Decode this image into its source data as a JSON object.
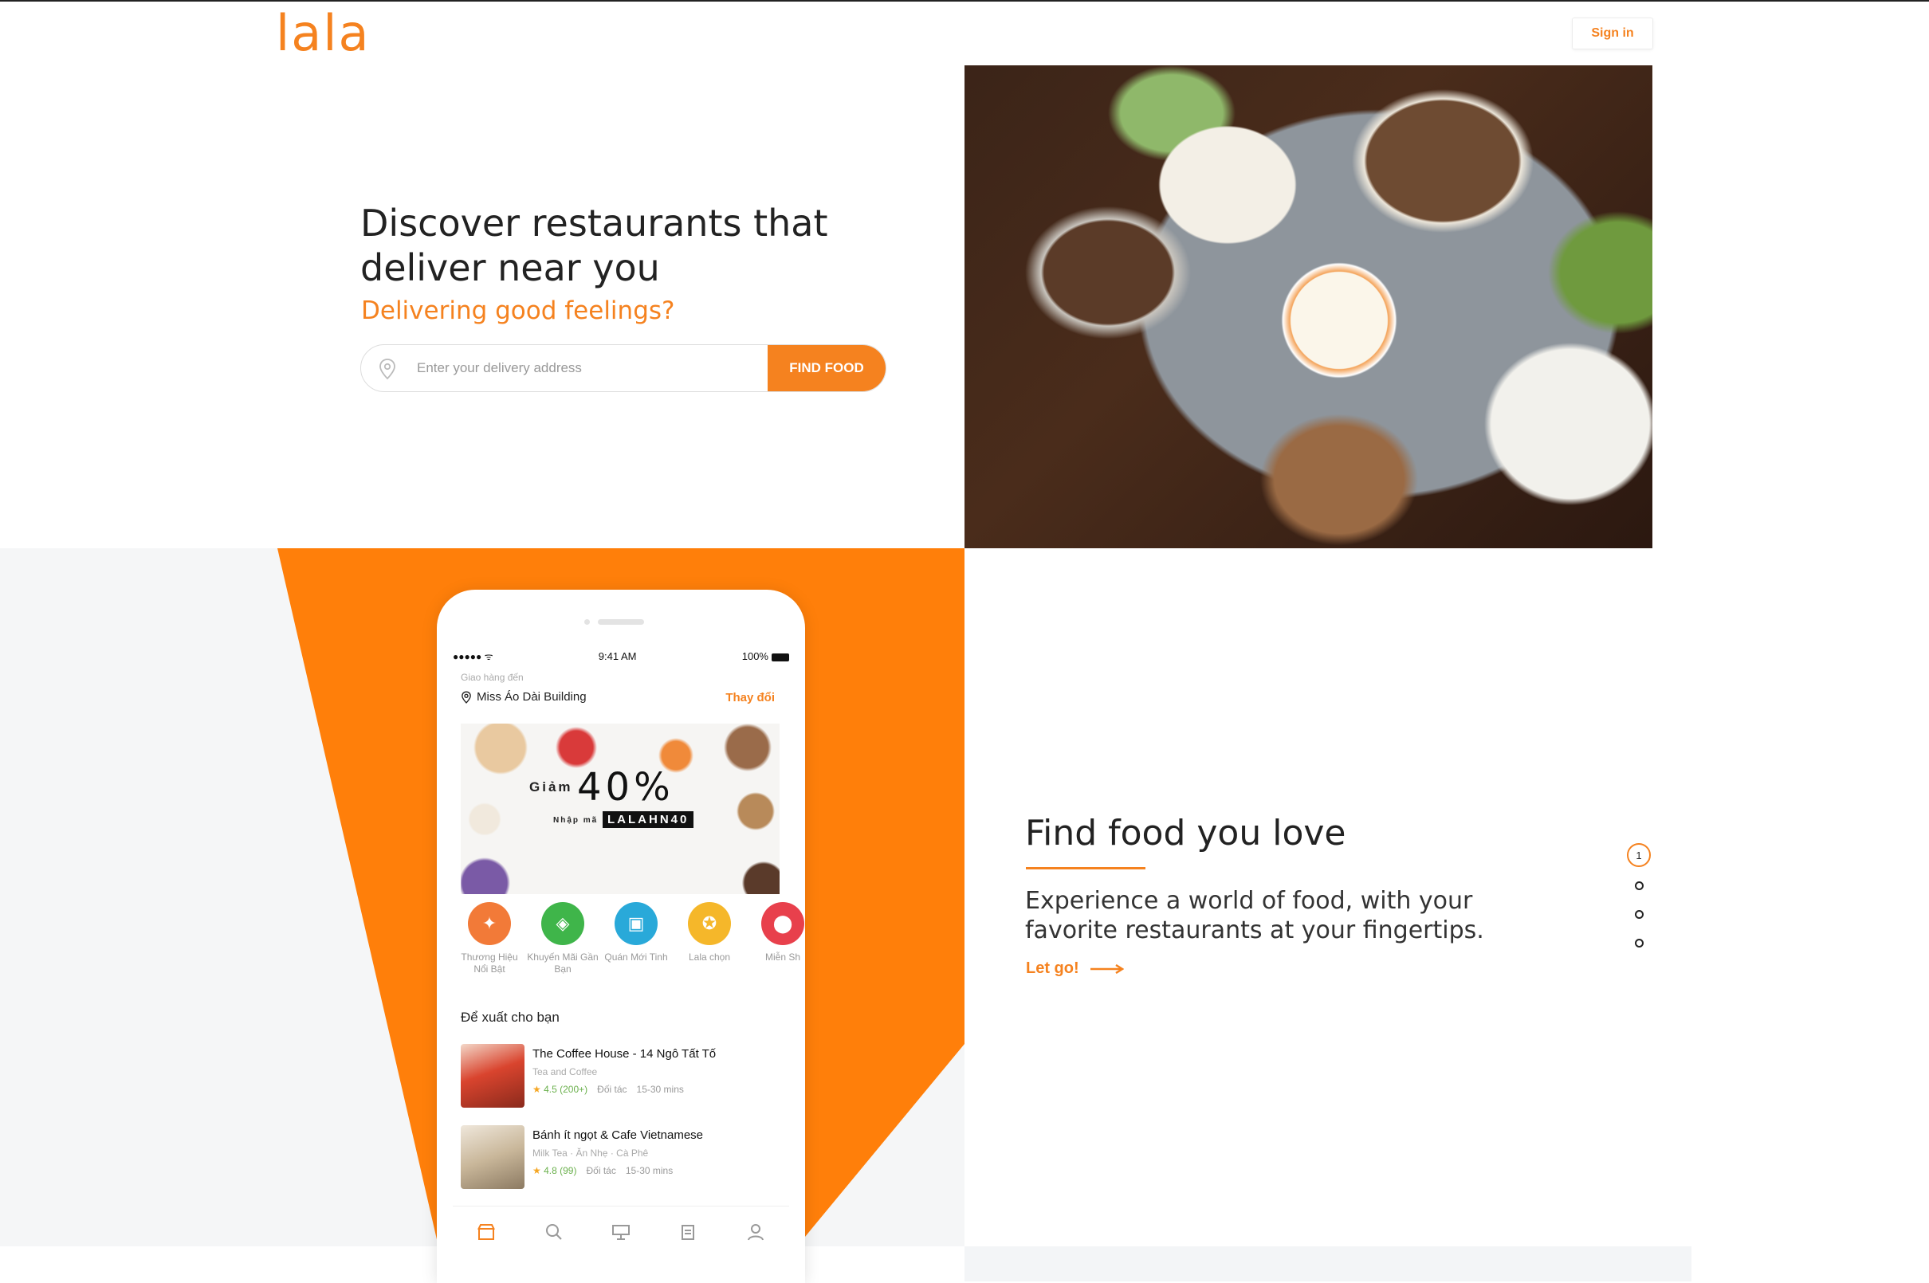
{
  "brand": {
    "logo": "lala",
    "accent": "#f5821f"
  },
  "header": {
    "signin_label": "Sign in"
  },
  "hero": {
    "title": "Discover restaurants that deliver near you",
    "subtitle": "Delivering good feelings?",
    "search_placeholder": "Enter your delivery address",
    "find_button": "FIND FOOD"
  },
  "phone": {
    "status": {
      "signal": "●●●●● ᯤ",
      "time": "9:41 AM",
      "battery": "100%"
    },
    "deliver_to_label": "Giao hàng đến",
    "location": "Miss Áo Dài Building",
    "change_label": "Thay đổi",
    "banner": {
      "discount_word": "Giảm",
      "discount": "40%",
      "code_label": "Nhập mã",
      "code": "LALAHN40"
    },
    "categories": [
      {
        "label": "Thương Hiệu Nổi Bật",
        "color": "#f27a38",
        "icon": "rocket-icon"
      },
      {
        "label": "Khuyến Mãi Gần Bạn",
        "color": "#3fb54a",
        "icon": "tag-icon"
      },
      {
        "label": "Quán Mới Tinh",
        "color": "#29a9d9",
        "icon": "store-icon"
      },
      {
        "label": "Lala chọn",
        "color": "#f5b72a",
        "icon": "badge-icon"
      },
      {
        "label": "Miễn Sh",
        "color": "#e8404c",
        "icon": "free-ship-icon"
      }
    ],
    "section_title": "Để xuất cho bạn",
    "restaurants": [
      {
        "name": "The Coffee House - 14 Ngô Tất Tố",
        "category": "Tea and Coffee",
        "rating": "4.5",
        "count": "(200+)",
        "partner": "Đối tác",
        "time": "15-30 mins"
      },
      {
        "name": "Bánh ít ngọt & Cafe Vietnamese",
        "category": "Milk Tea · Ăn Nhẹ · Cà Phê",
        "rating": "4.8",
        "count": "(99)",
        "partner": "Đối tác",
        "time": "15-30 mins"
      }
    ],
    "tabs": [
      "home-icon",
      "search-icon",
      "promo-icon",
      "orders-icon",
      "profile-icon"
    ]
  },
  "feature": {
    "title": "Find food you love",
    "description": "Experience a world of food, with your favorite restaurants at your fingertips.",
    "cta": "Let go!",
    "pager_current": "1"
  }
}
